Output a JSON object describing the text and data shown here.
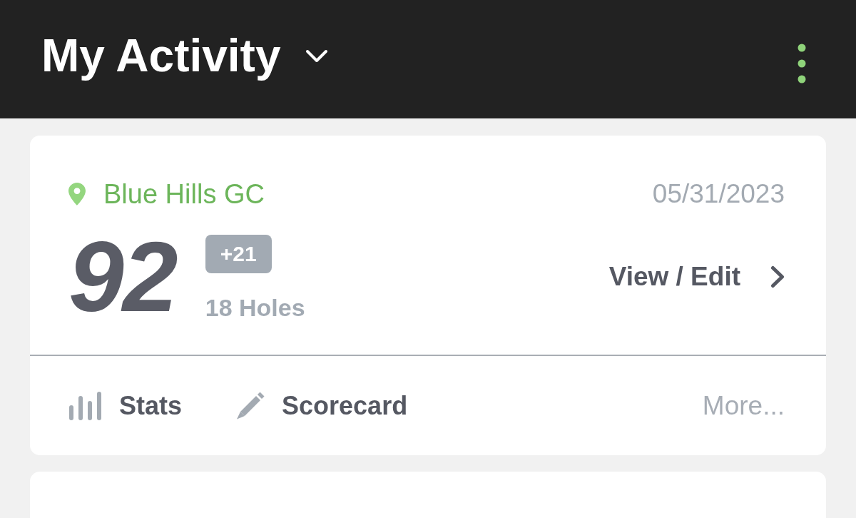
{
  "header": {
    "title": "My Activity"
  },
  "rounds": [
    {
      "course": "Blue Hills GC",
      "date": "05/31/2023",
      "score": "92",
      "over_par": "+21",
      "holes": "18 Holes",
      "view_link": "View / Edit",
      "actions": [
        {
          "kind": "stats",
          "label": "Stats"
        },
        {
          "kind": "scorecard",
          "label": "Scorecard"
        }
      ],
      "more": "More..."
    }
  ]
}
